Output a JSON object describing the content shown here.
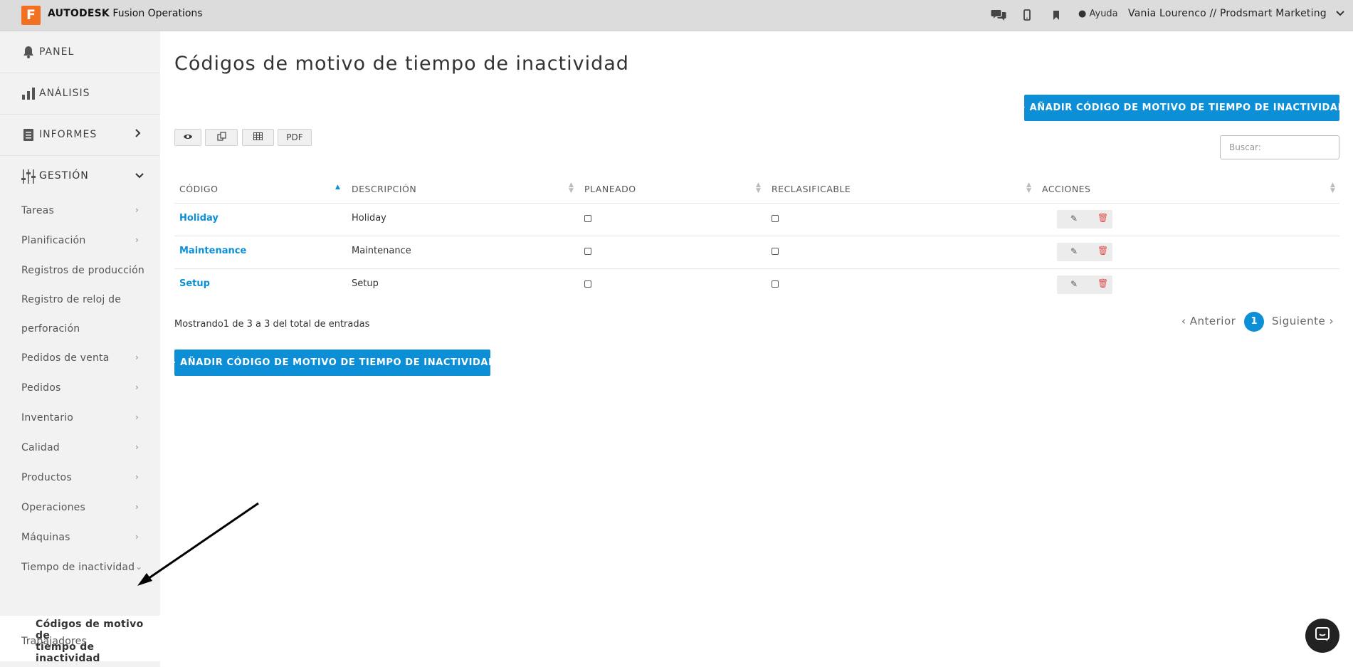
{
  "topbar": {
    "logo_letter": "F",
    "brand_bold": "AUTODESK",
    "brand_rest": " Fusion Operations",
    "help_label": "Ayuda",
    "user_label": "Vania Lourenco // Prodsmart Marketing",
    "icons": [
      "chat-icon",
      "mobile-icon",
      "bookmark-icon",
      "question-icon",
      "chevron-down-icon"
    ]
  },
  "sidebar": {
    "main": [
      {
        "label": "PANEL",
        "icon": "bell-icon"
      },
      {
        "label": "ANÁLISIS",
        "icon": "bar-chart-icon"
      },
      {
        "label": "INFORMES",
        "icon": "report-icon"
      },
      {
        "label": "GESTIÓN",
        "icon": "sliders-icon"
      }
    ],
    "sub": [
      "Tareas",
      "Planificación",
      "Registros de producción",
      "Registro de reloj de",
      "perforación",
      "Pedidos de venta",
      "Pedidos",
      "Inventario",
      "Calidad",
      "Productos",
      "Operaciones",
      "Máquinas",
      "Tiempo de inactividad",
      "Trabajadores"
    ],
    "active_line1": "Códigos de motivo de",
    "active_line2": "tiempo de inactividad"
  },
  "main": {
    "title": "Códigos de motivo de tiempo de inactividad",
    "add_button": "+ AÑADIR CÓDIGO DE MOTIVO DE TIEMPO DE INACTIVIDAD",
    "tools": {
      "pdf_label": "PDF"
    },
    "search_placeholder": "Buscar:",
    "columns": [
      "CÓDIGO",
      "DESCRIPCIÓN",
      "PLANEADO",
      "RECLASIFICABLE",
      "ACCIONES"
    ],
    "rows": [
      {
        "code": "Holiday",
        "description": "Holiday",
        "planned": false,
        "reclassifiable": false
      },
      {
        "code": "Maintenance",
        "description": "Maintenance",
        "planned": false,
        "reclassifiable": false
      },
      {
        "code": "Setup",
        "description": "Setup",
        "planned": false,
        "reclassifiable": false
      }
    ],
    "showing": "Mostrando1 de 3 a 3 del total de entradas",
    "pagination": {
      "prev": "‹ Anterior",
      "current": "1",
      "next": "Siguiente ›"
    }
  },
  "colors": {
    "accent": "#0d8fd8",
    "logo": "#f37021",
    "sidebar_bg": "#f2f2f2",
    "topbar_bg": "#dcdcdc",
    "delete": "#e05050"
  }
}
